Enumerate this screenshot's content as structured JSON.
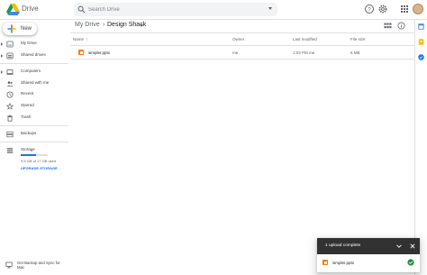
{
  "app": {
    "title": "Drive",
    "logo_icon": "google-drive-logo",
    "colors": {
      "accent": "#1a73e8",
      "pptx": "#f57c00",
      "success": "#1e8e3e",
      "toast_bg": "#323232"
    }
  },
  "header": {
    "search_placeholder": "Search Drive",
    "icons": [
      "search-icon",
      "search-options-icon",
      "help-icon",
      "settings-icon",
      "apps-grid-icon",
      "account-avatar"
    ]
  },
  "sidebar": {
    "new_label": "New",
    "items": [
      {
        "label": "My Drive",
        "icon": "my-drive-icon"
      },
      {
        "label": "Shared drives",
        "icon": "shared-drives-icon"
      },
      {
        "label": "Computers",
        "icon": "computers-icon"
      },
      {
        "label": "Shared with me",
        "icon": "shared-with-me-icon"
      },
      {
        "label": "Recent",
        "icon": "recent-clock-icon"
      },
      {
        "label": "Starred",
        "icon": "star-icon"
      },
      {
        "label": "Trash",
        "icon": "trash-icon"
      },
      {
        "label": "Backups",
        "icon": "backups-icon"
      },
      {
        "label": "Storage",
        "icon": "storage-icon"
      }
    ],
    "storage": {
      "used_text": "9.5 GB of 17 GB used",
      "used_fraction": 0.56,
      "upgrade_label": "UPGRADE STORAGE"
    },
    "backup_promo": "Get Backup and Sync for Mac"
  },
  "toolbar": {
    "breadcrumb": [
      "My Drive",
      "Design Shack"
    ],
    "separator": "›",
    "icons": [
      "grid-view-icon",
      "info-icon"
    ]
  },
  "file_list": {
    "columns": [
      "Name",
      "Owner",
      "Last modified",
      "File size"
    ],
    "sort_indicator": "↑",
    "rows": [
      {
        "name": "simpler.pptx",
        "owner": "me",
        "modified": "1:03 PM me",
        "size": "6 MB",
        "icon": "pptx-file-icon"
      }
    ]
  },
  "right_panel": {
    "icons": [
      "calendar-icon",
      "keep-icon",
      "tasks-icon"
    ]
  },
  "upload_toast": {
    "title": "1 upload complete",
    "file": "simpler.pptx",
    "status_icon": "check-circle-icon"
  }
}
